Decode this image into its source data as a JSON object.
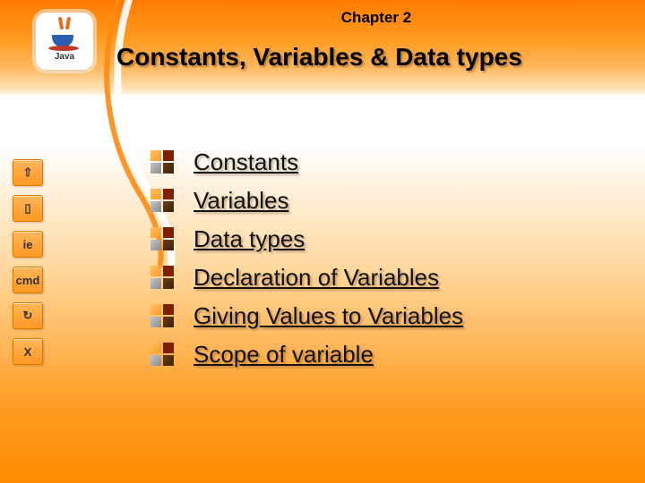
{
  "header": {
    "chapter": "Chapter 2",
    "title": "Constants, Variables & Data types",
    "logo_text": "Java"
  },
  "sidebar": {
    "buttons": [
      {
        "name": "up",
        "glyph": "⇧"
      },
      {
        "name": "doc",
        "glyph": "▯"
      },
      {
        "name": "ie",
        "glyph": "ie"
      },
      {
        "name": "cmd",
        "glyph": "cmd"
      },
      {
        "name": "redo",
        "glyph": "↻"
      },
      {
        "name": "close",
        "glyph": "X"
      }
    ]
  },
  "topics": [
    {
      "label": "Constants"
    },
    {
      "label": "Variables"
    },
    {
      "label": "Data types"
    },
    {
      "label": "Declaration of Variables"
    },
    {
      "label": "Giving Values to Variables"
    },
    {
      "label": "Scope of variable"
    }
  ]
}
